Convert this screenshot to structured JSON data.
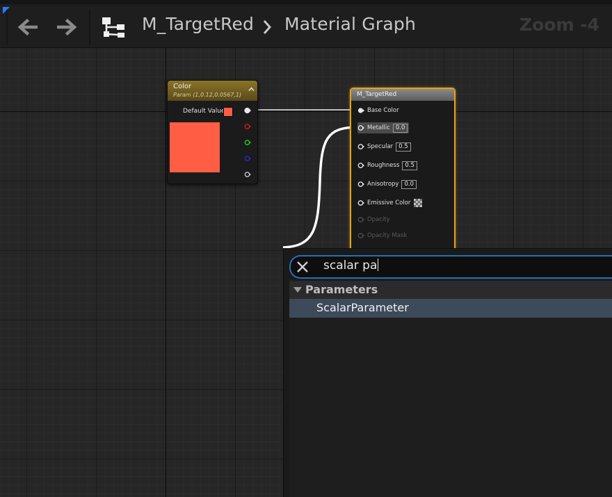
{
  "toolbar": {
    "back_icon": "arrow-left-icon",
    "forward_icon": "arrow-right-icon",
    "graph_icon": "material-graph-icon",
    "breadcrumb": [
      "M_TargetRed",
      "Material Graph"
    ],
    "zoom": "Zoom -4"
  },
  "color_node": {
    "title": "Color",
    "subtitle": "Param (1,0.12,0.0567,1)",
    "default_value_label": "Default Value",
    "color": "#ff5e45",
    "pin_colors": [
      "#e8e8e8",
      "#d41a1a",
      "#1ad41a",
      "#2a2ad4",
      "#c8c8c8"
    ]
  },
  "material_node": {
    "title": "M_TargetRed",
    "inputs": [
      {
        "label": "Base Color",
        "value": "",
        "connected": true
      },
      {
        "label": "Metallic",
        "value": "0.0",
        "connected": false,
        "highlighted": true
      },
      {
        "label": "Specular",
        "value": "0.5",
        "connected": false
      },
      {
        "label": "Roughness",
        "value": "0.5",
        "connected": false
      },
      {
        "label": "Anisotropy",
        "value": "0.0",
        "connected": false
      },
      {
        "label": "Emissive Color",
        "value": "checker",
        "connected": false
      },
      {
        "label": "Opacity",
        "value": "",
        "disabled": true
      },
      {
        "label": "Opacity Mask",
        "value": "",
        "disabled": true
      }
    ]
  },
  "action_menu": {
    "search_text": "scalar pa",
    "category": "Parameters",
    "items": [
      "ScalarParameter"
    ]
  },
  "colors": {
    "accent_border": "#e8a317",
    "selection": "#3d4a5a",
    "search_border": "#2a6fb5"
  }
}
